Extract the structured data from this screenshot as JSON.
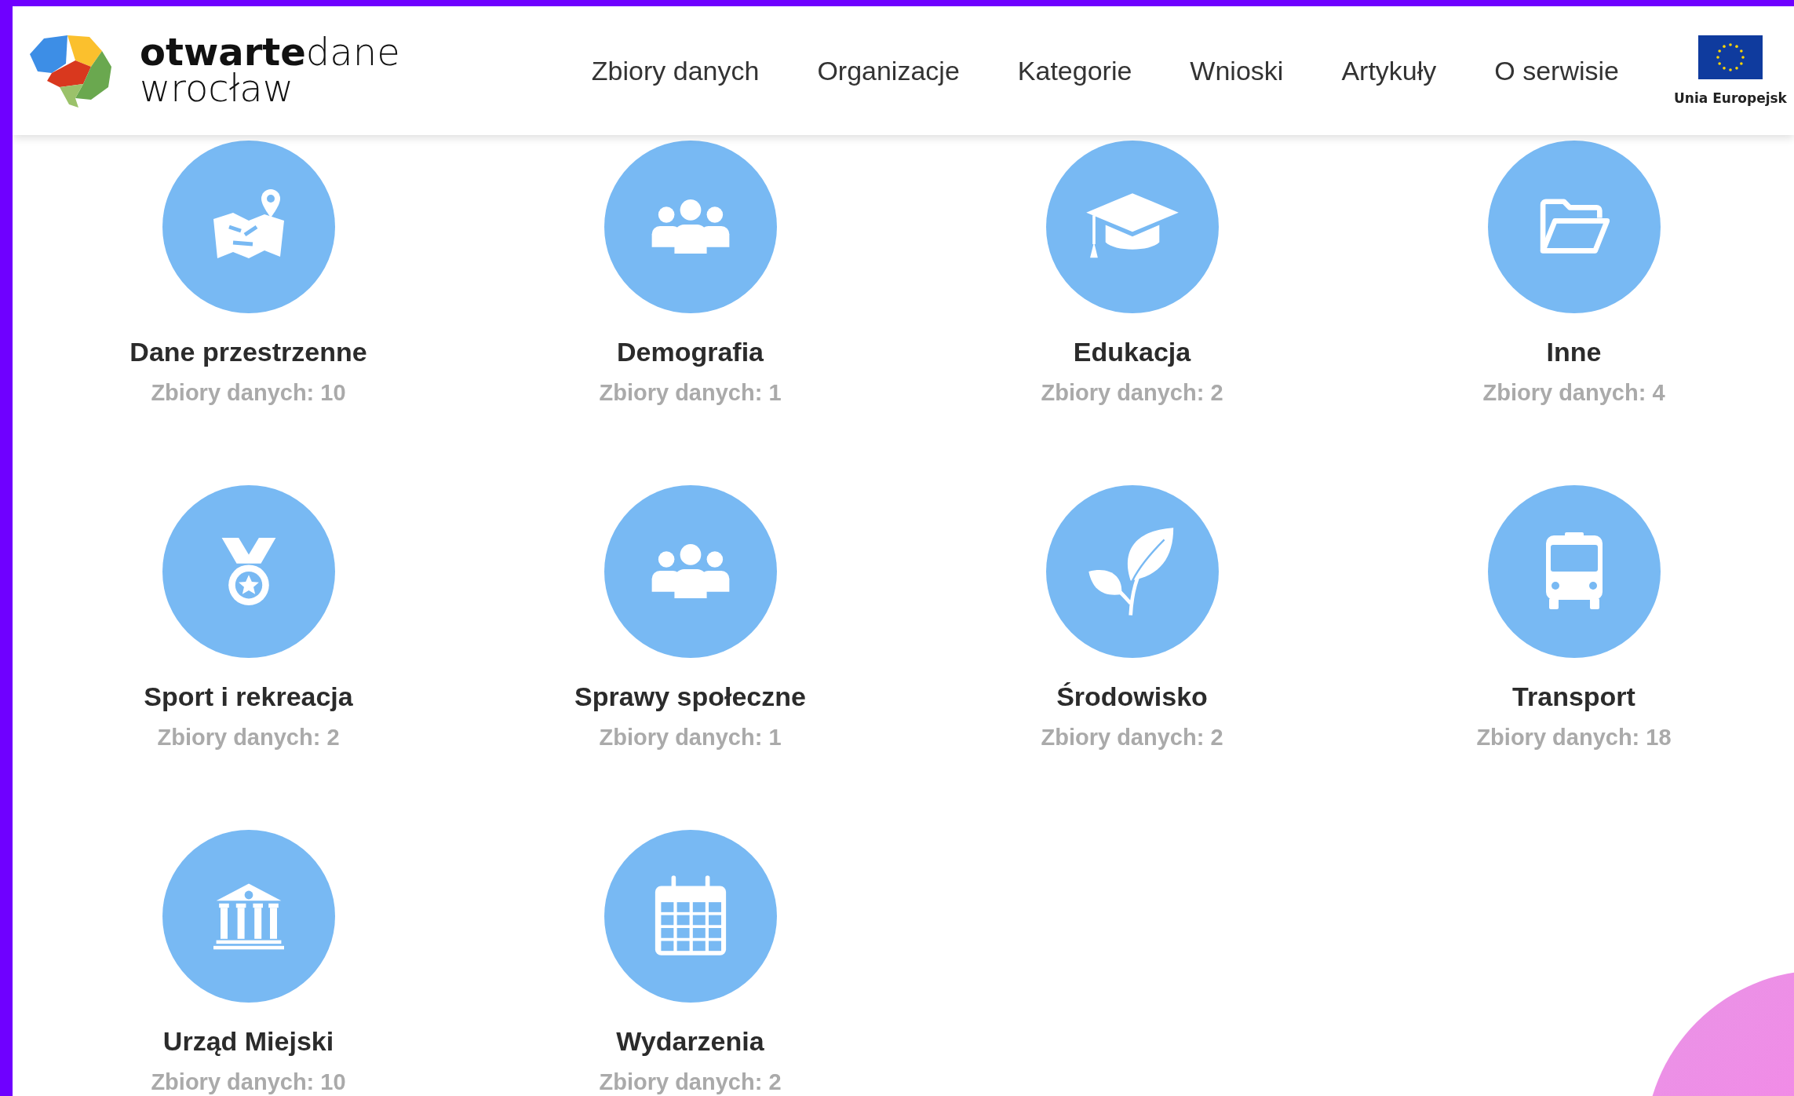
{
  "header": {
    "logo": {
      "bold": "otwarte",
      "light": "dane",
      "city": "wrocław"
    },
    "nav": [
      {
        "label": "Zbiory danych"
      },
      {
        "label": "Organizacje"
      },
      {
        "label": "Kategorie"
      },
      {
        "label": "Wnioski"
      },
      {
        "label": "Artykuły"
      },
      {
        "label": "O serwisie"
      }
    ],
    "eu_badge": "Unia Europejsk"
  },
  "categories": [
    {
      "kind": "map",
      "name": "Dane przestrzenne",
      "count": "Zbiory danych: 10"
    },
    {
      "kind": "people",
      "name": "Demografia",
      "count": "Zbiory danych: 1"
    },
    {
      "kind": "graduation",
      "name": "Edukacja",
      "count": "Zbiory danych: 2"
    },
    {
      "kind": "folder",
      "name": "Inne",
      "count": "Zbiory danych: 4"
    },
    {
      "kind": "medal",
      "name": "Sport i rekreacja",
      "count": "Zbiory danych: 2"
    },
    {
      "kind": "people",
      "name": "Sprawy społeczne",
      "count": "Zbiory danych: 1"
    },
    {
      "kind": "leaf",
      "name": "Środowisko",
      "count": "Zbiory danych: 2"
    },
    {
      "kind": "bus",
      "name": "Transport",
      "count": "Zbiory danych: 18"
    },
    {
      "kind": "bank",
      "name": "Urząd Miejski",
      "count": "Zbiory danych: 10"
    },
    {
      "kind": "calendar",
      "name": "Wydarzenia",
      "count": "Zbiory danych: 2"
    }
  ]
}
